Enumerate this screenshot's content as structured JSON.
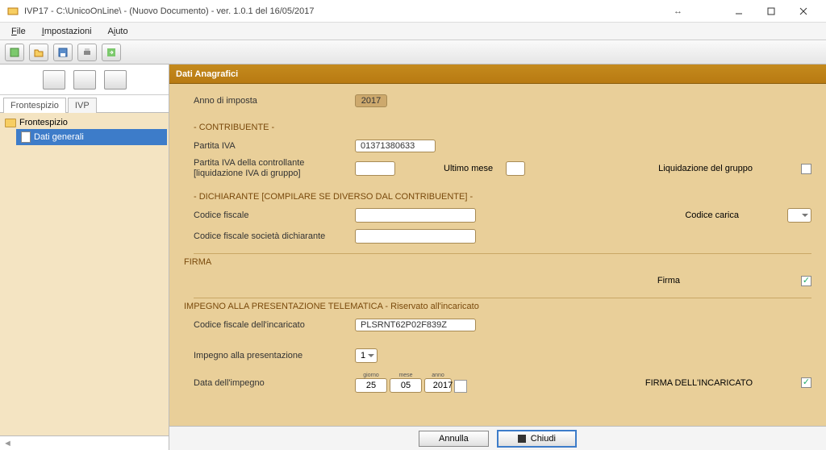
{
  "window": {
    "title": "IVP17 - C:\\UnicoOnLine\\ - (Nuovo Documento)  -  ver. 1.0.1 del 16/05/2017",
    "arrows": "↔"
  },
  "menubar": {
    "file": "File",
    "impostazioni": "Impostazioni",
    "aiuto": "Aiuto"
  },
  "left": {
    "tabs": {
      "frontespizio": "Frontespizio",
      "ivp": "IVP"
    },
    "tree": {
      "root": "Frontespizio",
      "child": "Dati generali"
    },
    "scroll_marker": "◄"
  },
  "form": {
    "header": "Dati Anagrafici",
    "anno_imposta_label": "Anno di imposta",
    "anno_imposta_value": "2017",
    "section_contribuente": "- CONTRIBUENTE -",
    "partita_iva_label": "Partita IVA",
    "partita_iva_value": "01371380633",
    "partita_iva_controllante_label1": "Partita IVA della controllante",
    "partita_iva_controllante_label2": "[liquidazione IVA di gruppo]",
    "partita_iva_controllante_value": "",
    "ultimo_mese_label": "Ultimo mese",
    "ultimo_mese_value": "",
    "liquidazione_gruppo_label": "Liquidazione del gruppo",
    "section_dichiarante": "- DICHIARANTE [COMPILARE SE DIVERSO DAL CONTRIBUENTE] -",
    "codice_fiscale_label": "Codice fiscale",
    "codice_fiscale_value": "",
    "codice_carica_label": "Codice carica",
    "codice_carica_value": "",
    "cf_societa_label": "Codice fiscale società dichiarante",
    "cf_societa_value": "",
    "section_firma": "FIRMA",
    "firma_label": "Firma",
    "section_impegno": "IMPEGNO ALLA PRESENTAZIONE TELEMATICA - Riservato all'incaricato",
    "cf_incaricato_label": "Codice fiscale dell'incaricato",
    "cf_incaricato_value": "PLSRNT62P02F839Z",
    "impegno_presentazione_label": "Impegno alla presentazione",
    "impegno_presentazione_value": "1",
    "data_impegno_label": "Data dell'impegno",
    "date_labels": {
      "giorno": "giorno",
      "mese": "mese",
      "anno": "anno"
    },
    "date_values": {
      "giorno": "25",
      "mese": "05",
      "anno": "2017"
    },
    "firma_incaricato_label": "FIRMA DELL'INCARICATO"
  },
  "footer": {
    "annulla": "Annulla",
    "chiudi": "Chiudi"
  }
}
